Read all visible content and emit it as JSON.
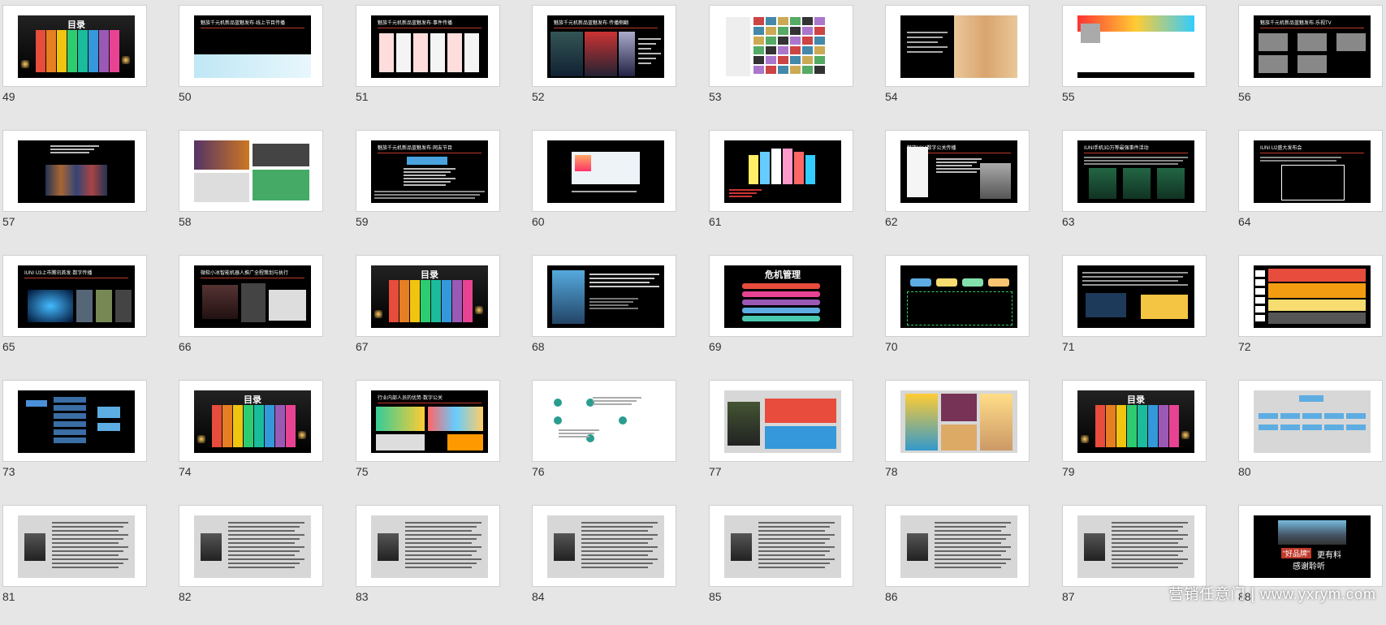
{
  "slides": [
    {
      "num": "49",
      "title": "目录",
      "kind": "menu"
    },
    {
      "num": "50",
      "header": "魅族千元机新品蓝魅发布·线上节目传播",
      "kind": "blue"
    },
    {
      "num": "51",
      "header": "魅族千元机新品蓝魅发布·事件传播",
      "kind": "phones"
    },
    {
      "num": "52",
      "header": "魅族千元机新品蓝魅发布·传播侧翻",
      "kind": "poster"
    },
    {
      "num": "53",
      "kind": "collage"
    },
    {
      "num": "54",
      "kind": "wood"
    },
    {
      "num": "55",
      "kind": "web"
    },
    {
      "num": "56",
      "header": "魅族千元机新品蓝魅发布·乐视TV",
      "kind": "screens"
    },
    {
      "num": "57",
      "kind": "crowd"
    },
    {
      "num": "58",
      "kind": "gallery"
    },
    {
      "num": "59",
      "header": "魅族千元机新品蓝魅发布·网友节目",
      "kind": "textdark"
    },
    {
      "num": "60",
      "kind": "ui"
    },
    {
      "num": "61",
      "kind": "colorphones"
    },
    {
      "num": "62",
      "header": "魅族MX4数字公关传播",
      "kind": "white-phone"
    },
    {
      "num": "63",
      "header": "IUNI手机3D万等最强事件活动",
      "kind": "green"
    },
    {
      "num": "64",
      "header": "IUNI U2盛大发布会",
      "kind": "frame"
    },
    {
      "num": "65",
      "header": "IUNI U3上市腾讯首发·数字传播",
      "kind": "blueglow"
    },
    {
      "num": "66",
      "header": "微软小冰智能机器人推广全程策划与执行",
      "kind": "dark-collage"
    },
    {
      "num": "67",
      "title": "目录",
      "kind": "menu"
    },
    {
      "num": "68",
      "kind": "person"
    },
    {
      "num": "69",
      "title": "危机管理",
      "kind": "crisis"
    },
    {
      "num": "70",
      "kind": "flow-green"
    },
    {
      "num": "71",
      "kind": "flow-yellow"
    },
    {
      "num": "72",
      "kind": "heat"
    },
    {
      "num": "73",
      "kind": "org-blue"
    },
    {
      "num": "74",
      "title": "目录",
      "kind": "menu"
    },
    {
      "num": "75",
      "header": "行业内部人员的优势·数字公关",
      "kind": "cartoon"
    },
    {
      "num": "76",
      "kind": "mindmap"
    },
    {
      "num": "77",
      "kind": "cases"
    },
    {
      "num": "78",
      "kind": "infograph"
    },
    {
      "num": "79",
      "title": "目录",
      "kind": "menu"
    },
    {
      "num": "80",
      "kind": "orgchart"
    },
    {
      "num": "81",
      "kind": "bio"
    },
    {
      "num": "82",
      "kind": "bio"
    },
    {
      "num": "83",
      "kind": "bio"
    },
    {
      "num": "84",
      "kind": "bio"
    },
    {
      "num": "85",
      "kind": "bio"
    },
    {
      "num": "86",
      "kind": "bio"
    },
    {
      "num": "87",
      "kind": "bio"
    },
    {
      "num": "88",
      "line1": "“好品牌”",
      "line2": "更有料",
      "line3": "感谢聆听",
      "kind": "road"
    }
  ],
  "watermark": "营销任意门 | www.yxrym.com",
  "colors": {
    "rainbow": [
      "#e74c3c",
      "#e67e22",
      "#f1c40f",
      "#2ecc71",
      "#1abc9c",
      "#3498db",
      "#9b59b6",
      "#e84393"
    ]
  }
}
